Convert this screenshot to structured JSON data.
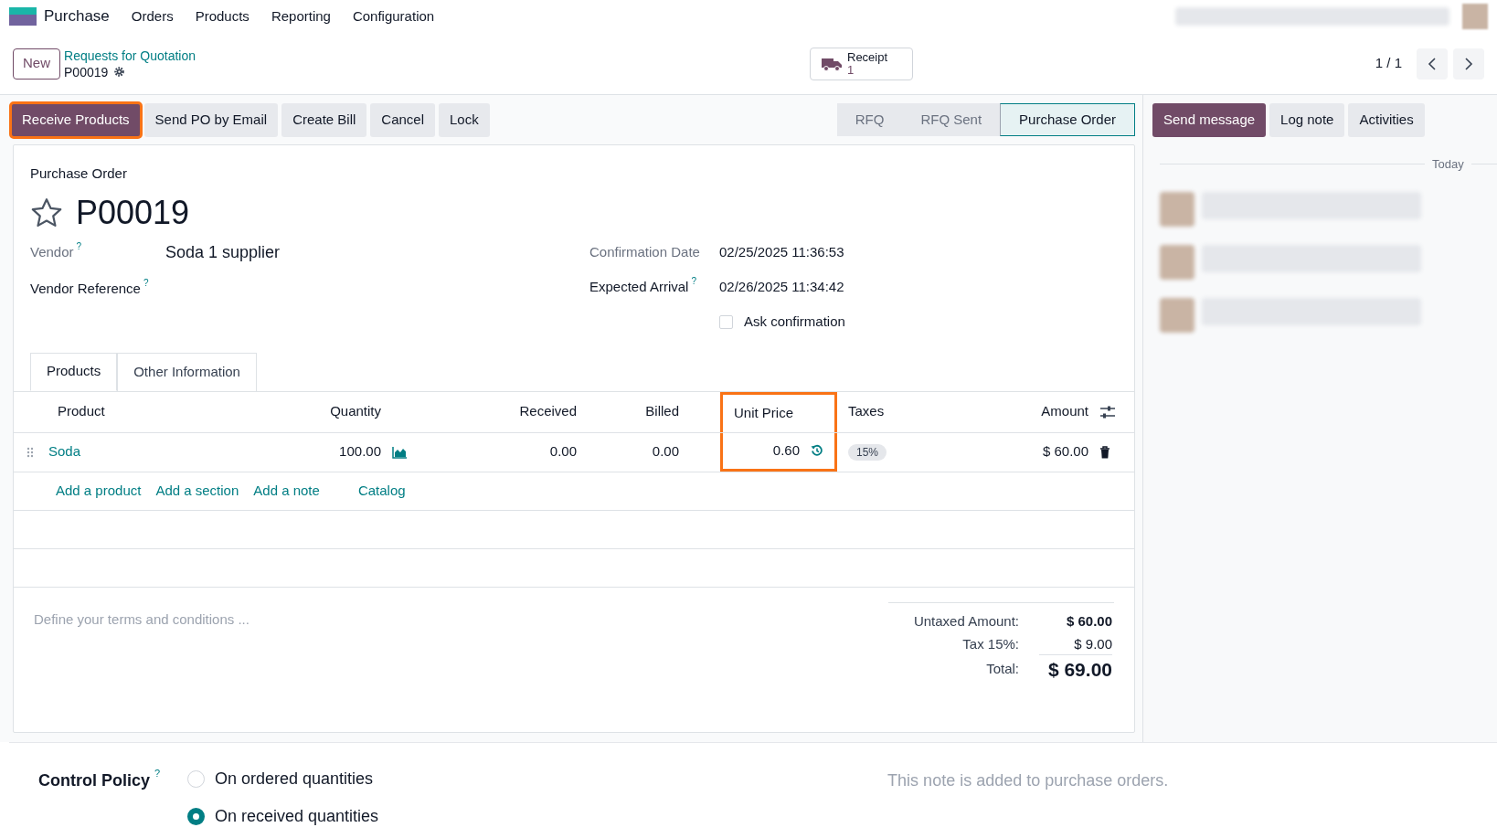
{
  "navbar": {
    "app": "Purchase",
    "menu": [
      "Orders",
      "Products",
      "Reporting",
      "Configuration"
    ]
  },
  "control_panel": {
    "new_button": "New",
    "breadcrumb": "Requests for Quotation",
    "record": "P00019",
    "smart_button": {
      "label": "Receipt",
      "count": "1"
    },
    "pager": "1 / 1"
  },
  "actions": [
    {
      "label": "Receive Products",
      "primary": true,
      "highlighted": true
    },
    {
      "label": "Send PO by Email",
      "primary": false,
      "highlighted": false
    },
    {
      "label": "Create Bill",
      "primary": false,
      "highlighted": false
    },
    {
      "label": "Cancel",
      "primary": false,
      "highlighted": false
    },
    {
      "label": "Lock",
      "primary": false,
      "highlighted": false
    }
  ],
  "statusbar": [
    {
      "label": "RFQ",
      "selected": false
    },
    {
      "label": "RFQ Sent",
      "selected": false
    },
    {
      "label": "Purchase Order",
      "selected": true
    }
  ],
  "chatter_buttons": [
    {
      "label": "Send message",
      "primary": true
    },
    {
      "label": "Log note",
      "primary": false
    },
    {
      "label": "Activities",
      "primary": false
    }
  ],
  "form": {
    "type_label": "Purchase Order",
    "name": "P00019",
    "starred": false,
    "left_fields": [
      {
        "label": "Vendor",
        "help": "?",
        "readonly": true,
        "value": "Soda 1 supplier"
      },
      {
        "label": "Vendor Reference",
        "help": "?",
        "readonly": false
      }
    ],
    "right_fields": [
      {
        "label": "Confirmation Date",
        "readonly": true,
        "value": "02/25/2025 11:36:53"
      },
      {
        "label": "Expected Arrival",
        "help": "?",
        "readonly": false,
        "value": "02/26/2025 11:34:42"
      }
    ],
    "ask_confirmation": {
      "label": "Ask confirmation",
      "checked": false
    }
  },
  "tabs": [
    {
      "label": "Products",
      "selected": true
    },
    {
      "label": "Other Information",
      "selected": false
    }
  ],
  "table": {
    "columns": [
      {
        "label": "Product",
        "highlighted": false
      },
      {
        "label": "Quantity",
        "highlighted": false
      },
      {
        "label": "Received",
        "highlighted": false
      },
      {
        "label": "Billed",
        "highlighted": false
      },
      {
        "label": "Unit Price",
        "highlighted": true
      },
      {
        "label": "Taxes",
        "highlighted": false
      },
      {
        "label": "Amount",
        "highlighted": false
      }
    ],
    "rows": [
      {
        "product": "Soda",
        "quantity": "100.00",
        "received": "0.00",
        "billed": "0.00",
        "unit_price": "0.60",
        "taxes": "15%",
        "amount": "$ 60.00"
      }
    ],
    "add_links": [
      "Add a product",
      "Add a section",
      "Add a note",
      "Catalog"
    ]
  },
  "terms_placeholder": "Define your terms and conditions ...",
  "totals": [
    {
      "label": "Untaxed Amount:",
      "value": "$ 60.00",
      "kind": "subtotal"
    },
    {
      "label": "Tax 15%:",
      "value": "$ 9.00",
      "kind": "tax"
    },
    {
      "label": "Total:",
      "value": "$ 69.00",
      "kind": "total"
    }
  ],
  "chatter": {
    "date_separator": "Today"
  },
  "control_policy": {
    "label": "Control Policy",
    "help": "?",
    "options": [
      {
        "label": "On ordered quantities",
        "selected": false
      },
      {
        "label": "On received quantities",
        "selected": true
      }
    ],
    "note": "This note is added to purchase orders."
  }
}
